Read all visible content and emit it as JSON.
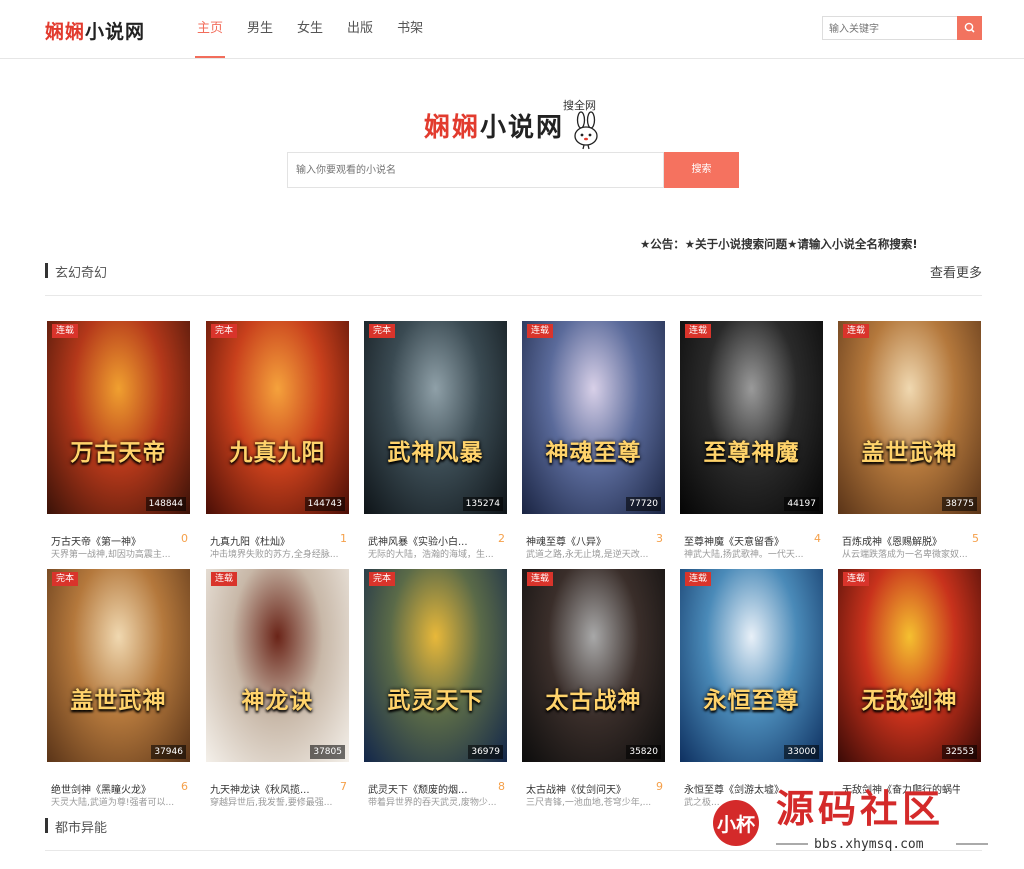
{
  "header": {
    "logo_red": "娴娴",
    "logo_black": "小说网",
    "nav": [
      {
        "label": "主页",
        "active": true
      },
      {
        "label": "男生",
        "active": false
      },
      {
        "label": "女生",
        "active": false
      },
      {
        "label": "出版",
        "active": false
      },
      {
        "label": "书架",
        "active": false
      }
    ],
    "search_placeholder": "输入关键字",
    "search_icon": "search-icon"
  },
  "hero": {
    "logo_red": "娴娴",
    "logo_black": "小说网",
    "logo_sub": "搜全网",
    "search_placeholder": "输入你要观看的小说名",
    "search_button": "搜索"
  },
  "notice": "★公告：★关于小说搜索问题★请输入小说全名称搜索!",
  "section1": {
    "title": "玄幻奇幻",
    "more": "查看更多"
  },
  "section2": {
    "title": "都市异能"
  },
  "books": [
    {
      "tag": "连载",
      "count": "148844",
      "title": "万古天帝《第一神》",
      "rank": "0",
      "desc": "天界第一战神,却因功高震主...",
      "cover_title": "万古天帝",
      "colors": [
        "#3a1208",
        "#b4381a",
        "#f0a030"
      ]
    },
    {
      "tag": "完本",
      "count": "144743",
      "title": "九真九阳《杜灿》",
      "rank": "1",
      "desc": "冲击境界失败的苏方,全身经脉...",
      "cover_title": "九真九阳",
      "colors": [
        "#4a0e06",
        "#c8401c",
        "#f5a23c"
      ]
    },
    {
      "tag": "完本",
      "count": "135274",
      "title": "武神风暴《实验小白...",
      "rank": "2",
      "desc": "无际的大陆，浩瀚的海域，生...",
      "cover_title": "武神风暴",
      "colors": [
        "#0e1418",
        "#3a4a52",
        "#8fa0a8"
      ]
    },
    {
      "tag": "连载",
      "count": "77720",
      "title": "神魂至尊《八异》",
      "rank": "3",
      "desc": "武道之路,永无止境,是逆天改...",
      "cover_title": "神魂至尊",
      "colors": [
        "#1a2442",
        "#5a6a9a",
        "#d8d0e8"
      ]
    },
    {
      "tag": "连载",
      "count": "44197",
      "title": "至尊神魔《天意留香》",
      "rank": "4",
      "desc": "神武大陆,扬武歌神。一代天...",
      "cover_title": "至尊神魔",
      "colors": [
        "#050505",
        "#2a2a2a",
        "#9a9a9a"
      ]
    },
    {
      "tag": "连载",
      "count": "38775",
      "title": "百炼成神《恩赐解脱》",
      "rank": "5",
      "desc": "从云端跌落成为一名卑微家奴...",
      "cover_title": "盖世武神",
      "colors": [
        "#5a3418",
        "#b4783c",
        "#f0d8b0"
      ]
    },
    {
      "tag": "完本",
      "count": "37946",
      "title": "绝世剑神《黑瞳火龙》",
      "rank": "6",
      "desc": "天灵大陆,武道为尊!强者可以...",
      "cover_title": "盖世武神",
      "colors": [
        "#5a3418",
        "#b4783c",
        "#f0d8b0"
      ]
    },
    {
      "tag": "连载",
      "count": "37805",
      "title": "九天神龙诀《秋风揽...",
      "rank": "7",
      "desc": "穿越异世后,我发誓,要修最强...",
      "cover_title": "神龙诀",
      "colors": [
        "#f4f0ea",
        "#c8b8a8",
        "#6a2418"
      ]
    },
    {
      "tag": "完本",
      "count": "36979",
      "title": "武灵天下《颓废的烟...",
      "rank": "8",
      "desc": "带着异世界的吞天武灵,废物少...",
      "cover_title": "武灵天下",
      "colors": [
        "#12264a",
        "#5a6a48",
        "#e8b83a"
      ]
    },
    {
      "tag": "连载",
      "count": "35820",
      "title": "太古战神《仗剑问天》",
      "rank": "9",
      "desc": "三尺青锋,一池血地,苍穹少年,...",
      "cover_title": "太古战神",
      "colors": [
        "#0c0c0c",
        "#3a2e2a",
        "#a8a8a8"
      ]
    },
    {
      "tag": "连载",
      "count": "33000",
      "title": "永恒至尊《剑游太墟》",
      "rank": "",
      "desc": "武之极...",
      "cover_title": "永恒至尊",
      "colors": [
        "#0e3060",
        "#4a8ab8",
        "#e8f0f8"
      ]
    },
    {
      "tag": "连载",
      "count": "32553",
      "title": "无敌剑神《奋力爬行的蜗牛》",
      "rank": "",
      "desc": "",
      "cover_title": "无敌剑神",
      "colors": [
        "#3a0a06",
        "#c8321c",
        "#f5c030"
      ]
    }
  ],
  "watermark": {
    "stamp": "小杯",
    "title": "源码社区",
    "url": "bbs.xhymsq.com"
  }
}
